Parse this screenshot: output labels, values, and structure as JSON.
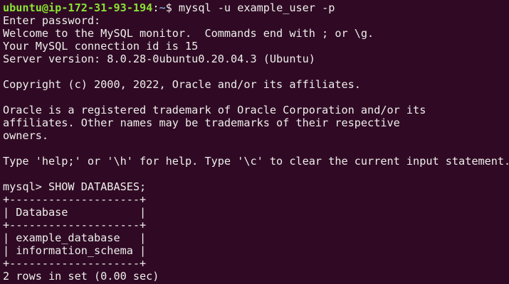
{
  "prompt": {
    "user_host": "ubuntu@ip-172-31-93-194",
    "separator": ":",
    "path": "~",
    "symbol": "$ ",
    "command": "mysql -u example_user -p"
  },
  "output_lines": [
    "Enter password:",
    "Welcome to the MySQL monitor.  Commands end with ; or \\g.",
    "Your MySQL connection id is 15",
    "Server version: 8.0.28-0ubuntu0.20.04.3 (Ubuntu)",
    "",
    "Copyright (c) 2000, 2022, Oracle and/or its affiliates.",
    "",
    "Oracle is a registered trademark of Oracle Corporation and/or its",
    "affiliates. Other names may be trademarks of their respective",
    "owners.",
    "",
    "Type 'help;' or '\\h' for help. Type '\\c' to clear the current input statement.",
    "",
    "mysql> SHOW DATABASES;"
  ],
  "result_table": {
    "border": "+--------------------+",
    "header": "| Database           |",
    "rows": [
      "| example_database   |",
      "| information_schema |"
    ],
    "footer": "2 rows in set (0.00 sec)"
  },
  "colors": {
    "background": "#300a24",
    "text": "#eeeeec",
    "user": "#8ae234",
    "path": "#729fcf"
  }
}
